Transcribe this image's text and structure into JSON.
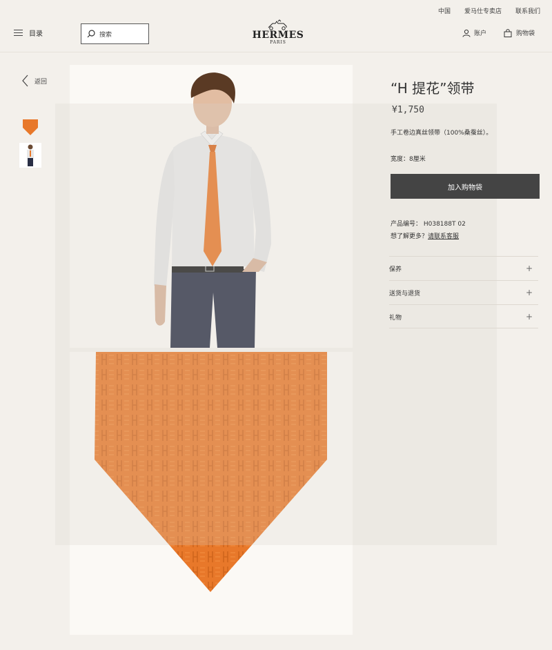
{
  "utility": {
    "china": "中国",
    "stores": "爱马仕专卖店",
    "contact": "联系我们"
  },
  "header": {
    "menu_label": "目录",
    "search_placeholder": "搜索",
    "logo_brand": "HERMES",
    "logo_city": "PARIS",
    "account_label": "账户",
    "cart_label": "购物袋"
  },
  "nav": {
    "back_label": "返回"
  },
  "product": {
    "title": "“H 提花”领带",
    "price": "¥1,750",
    "description": "手工卷边真丝领带（100%桑蚕丝）。",
    "width": "宽度：8厘米",
    "add_to_cart": "加入购物袋",
    "reference": "产品编号： H038188T 02",
    "more_prefix": "想了解更多？",
    "more_link": "请联系客服"
  },
  "accordion": [
    {
      "label": "保养"
    },
    {
      "label": "送货与退货"
    },
    {
      "label": "礼物"
    }
  ],
  "colors": {
    "tie_orange": "#e8782a",
    "button_dark": "#444444",
    "background": "#f3f0eb"
  }
}
